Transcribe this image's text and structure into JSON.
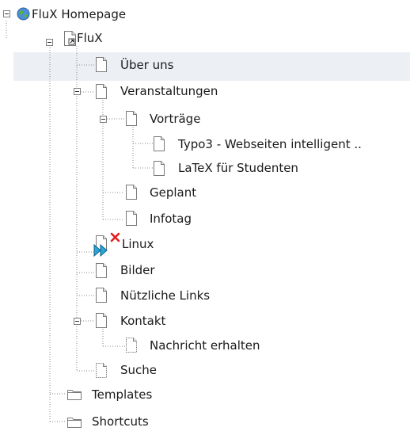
{
  "tree": {
    "root": {
      "label": "FluX Homepage",
      "icon": "globe-icon"
    },
    "site": {
      "label": "FluX",
      "icon": "page-shortcut-icon"
    },
    "items": {
      "ueber_uns": "Über uns",
      "veranstaltungen": "Veranstaltungen",
      "vortraege": "Vorträge",
      "typo3": "Typo3 - Webseiten intelligent ..",
      "latex": "LaTeX für Studenten",
      "geplant": "Geplant",
      "infotag": "Infotag",
      "linux": "Linux",
      "bilder": "Bilder",
      "links": "Nützliche Links",
      "kontakt": "Kontakt",
      "nachricht": "Nachricht erhalten",
      "suche": "Suche",
      "templates": "Templates",
      "shortcuts": "Shortcuts"
    },
    "highlighted_item": "ueber_uns",
    "linux_status": {
      "overlay": "deleted-x-icon",
      "badge": "moved-arrows-icon"
    }
  }
}
